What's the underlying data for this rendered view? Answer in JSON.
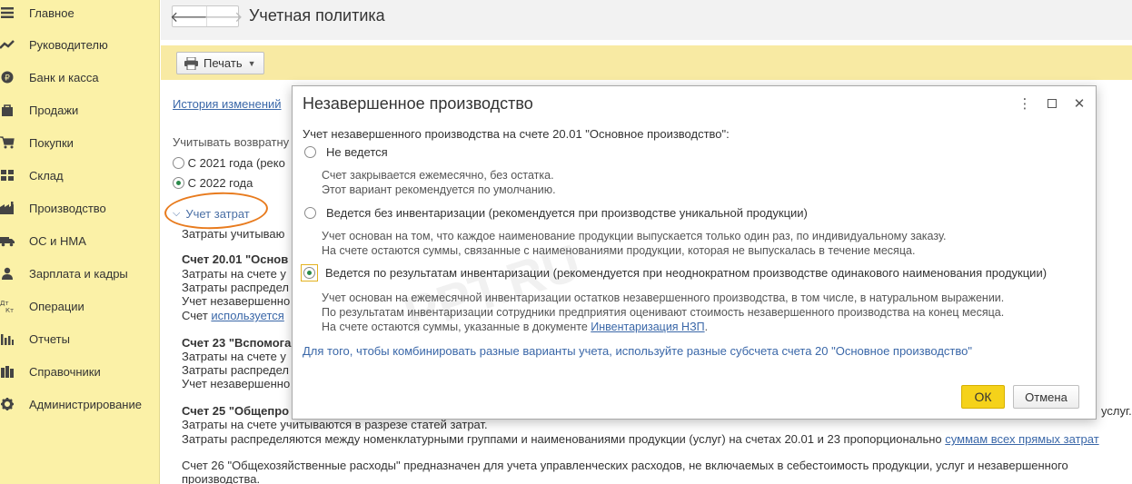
{
  "sidebar": {
    "items": [
      {
        "label": "Главное",
        "icon": "menu-icon"
      },
      {
        "label": "Руководителю",
        "icon": "chart-trend-icon"
      },
      {
        "label": "Банк и касса",
        "icon": "coin-icon"
      },
      {
        "label": "Продажи",
        "icon": "shopping-bag-icon"
      },
      {
        "label": "Покупки",
        "icon": "cart-icon"
      },
      {
        "label": "Склад",
        "icon": "warehouse-grid-icon"
      },
      {
        "label": "Производство",
        "icon": "factory-icon"
      },
      {
        "label": "ОС и НМА",
        "icon": "truck-icon"
      },
      {
        "label": "Зарплата и кадры",
        "icon": "person-icon"
      },
      {
        "label": "Операции",
        "icon": "dt-kt-icon"
      },
      {
        "label": "Отчеты",
        "icon": "bar-chart-icon"
      },
      {
        "label": "Справочники",
        "icon": "books-icon"
      },
      {
        "label": "Администрирование",
        "icon": "gear-icon"
      }
    ]
  },
  "header": {
    "title": "Учетная политика",
    "back_icon": "arrow-left-icon",
    "forward_icon": "arrow-right-icon"
  },
  "toolbar": {
    "print_label": "Печать"
  },
  "background": {
    "history_link": "История изменений",
    "return_label": "Учитывать возвратну",
    "radio_2021": "С 2021 года (реко",
    "radio_2022": "С 2022 года",
    "cost_group": "Учет затрат",
    "lines": [
      "Затраты учитываю",
      "Счет 20.01 \"Основ",
      "Затраты на счете у",
      "Затраты распредел",
      "Учет незавершенно",
      "Счет ",
      "Счет 23 \"Вспомога",
      "Затраты на счете у",
      "Затраты распредел",
      "Учет незавершенно",
      "Счет 25 \"Общепро",
      "Затраты на счете учитываются в разрезе статей затрат.",
      "Затраты распределяются между номенклатурными группами и наименованиями продукции (услуг) на счетах 20.01 и 23 пропорционально ",
      "Счет 26 \"Общехозяйственные расходы\" предназначен для учета управленческих расходов, не включаемых в себестоимость продукции, услуг и незавершенного",
      "производства."
    ],
    "used_link": "используется",
    "direct_costs_link": "суммам всех прямых затрат",
    "right_tail": "услуг."
  },
  "dialog": {
    "title": "Незавершенное производство",
    "question": "Учет незавершенного производства на счете 20.01 \"Основное производство\":",
    "options": [
      {
        "label": "Не ведется",
        "hints": [
          "Счет закрывается ежемесячно, без остатка.",
          "Этот вариант рекомендуется по умолчанию."
        ],
        "selected": false
      },
      {
        "label": "Ведется без инвентаризации (рекомендуется при производстве уникальной продукции)",
        "hints": [
          "Учет основан на том, что каждое наименование продукции выпускается только один раз, по индивидуальному заказу.",
          "На счете остаются суммы, связанные с наименованиями продукции, которая не выпускалась в течение месяца."
        ],
        "selected": false
      },
      {
        "label": "Ведется по результатам инвентаризации (рекомендуется при неоднократном производстве одинакового наименования продукции)",
        "hints": [
          "Учет основан на ежемесячной инвентаризации остатков незавершенного производства, в том числе, в натуральном выражении.",
          "По результатам инвентаризации сотрудники предприятия оценивают стоимость незавершенного производства на конец месяца.",
          "На счете остаются суммы, указанные в документе "
        ],
        "hint_link": "Инвентаризация НЗП",
        "selected": true
      }
    ],
    "footer_note": "Для того, чтобы комбинировать разные варианты учета, используйте разные субсчета счета 20 \"Основное производство\"",
    "ok_label": "ОК",
    "cancel_label": "Отмена"
  },
  "watermark": "PPT.RU",
  "colors": {
    "sidebar_bg": "#fbf1a7",
    "command_bar_bg": "#f8eaa3",
    "ok_button": "#f5d21a",
    "link": "#3a67a8",
    "highlight_oval": "#e87b1e"
  }
}
